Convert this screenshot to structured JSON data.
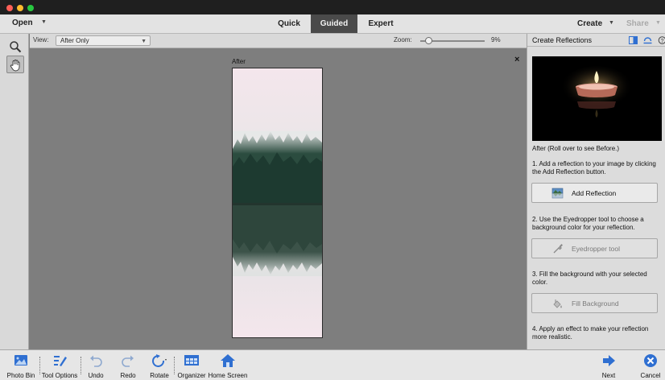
{
  "menubar": {
    "open_label": "Open",
    "modes": [
      "Quick",
      "Guided",
      "Expert"
    ],
    "active_mode": "Guided",
    "create_label": "Create",
    "share_label": "Share"
  },
  "options": {
    "view_label": "View:",
    "view_value": "After Only",
    "zoom_label": "Zoom:",
    "zoom_value": "9%",
    "zoom_level": 0.09
  },
  "canvas": {
    "after_label": "After",
    "close_glyph": "×"
  },
  "panel": {
    "title": "Create Reflections",
    "preview_caption": "After (Roll over to see Before.)",
    "steps": [
      {
        "text": "1. Add a reflection to your image by clicking the Add Reflection button.",
        "button": "Add Reflection",
        "enabled": true,
        "icon": "add-reflection-icon"
      },
      {
        "text": "2. Use the Eyedropper tool to choose a background color for your reflection.",
        "button": "Eyedropper tool",
        "enabled": false,
        "icon": "eyedropper-icon"
      },
      {
        "text": "3. Fill the background with your selected color.",
        "button": "Fill Background",
        "enabled": false,
        "icon": "paint-bucket-icon"
      },
      {
        "text": "4. Apply an effect to make your reflection more realistic."
      }
    ]
  },
  "bottombar": {
    "photo_bin": "Photo Bin",
    "tool_options": "Tool Options",
    "undo": "Undo",
    "redo": "Redo",
    "rotate": "Rotate",
    "organizer": "Organizer",
    "home_screen": "Home Screen",
    "next": "Next",
    "cancel": "Cancel"
  },
  "colors": {
    "accent_blue": "#2f6fd1",
    "active_tab": "#4a4a4a"
  }
}
